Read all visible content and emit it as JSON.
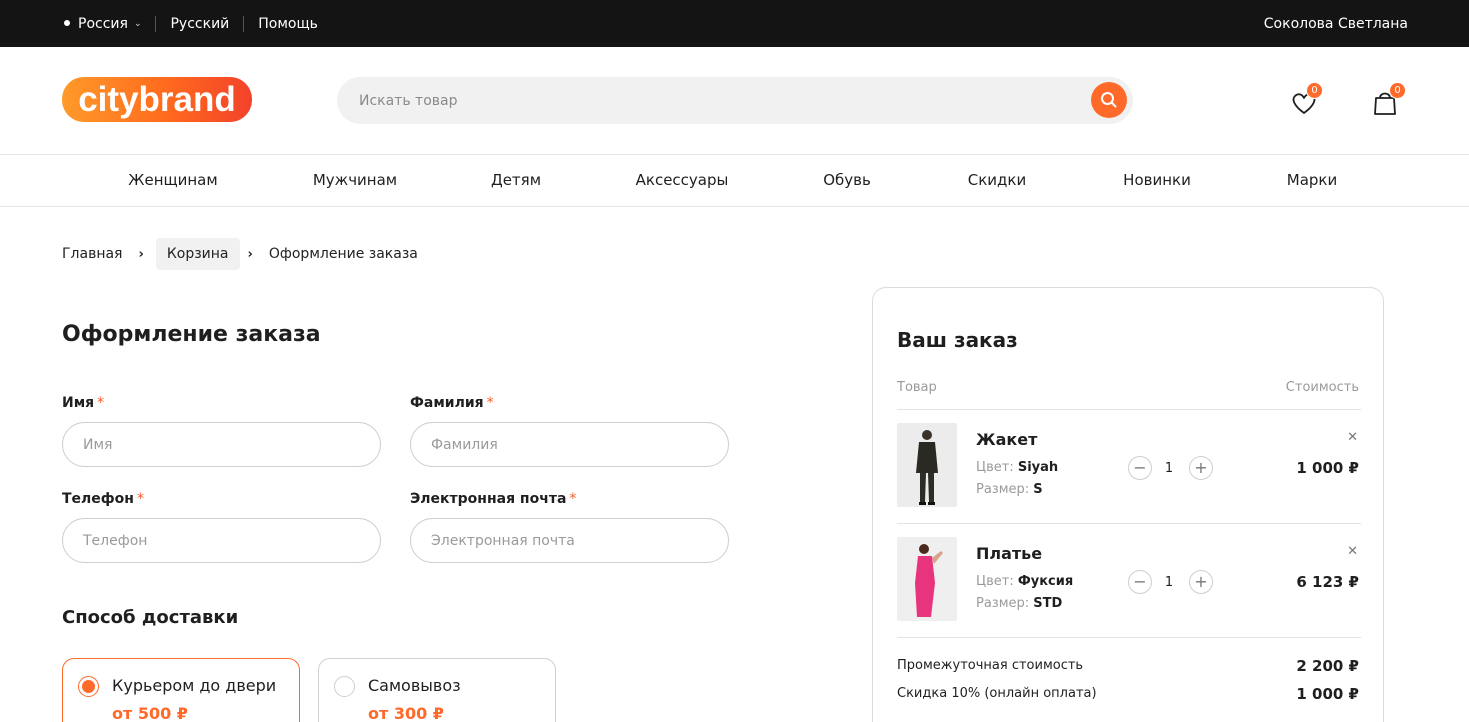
{
  "topbar": {
    "country": "Россия",
    "language": "Русский",
    "help": "Помощь",
    "user": "Соколова Светлана"
  },
  "header": {
    "logo_text": "citybrand",
    "search_placeholder": "Искать товар",
    "wishlist_count": "0",
    "cart_count": "0"
  },
  "nav": [
    "Женщинам",
    "Мужчинам",
    "Детям",
    "Аксессуары",
    "Обувь",
    "Скидки",
    "Новинки",
    "Марки"
  ],
  "breadcrumb": {
    "home": "Главная",
    "cart": "Корзина",
    "current": "Оформление заказа"
  },
  "form": {
    "title": "Оформление заказа",
    "first_name_label": "Имя",
    "first_name_placeholder": "Имя",
    "last_name_label": "Фамилия",
    "last_name_placeholder": "Фамилия",
    "phone_label": "Телефон",
    "phone_placeholder": "Телефон",
    "email_label": "Электронная почта",
    "email_placeholder": "Электронная почта",
    "required_mark": "*"
  },
  "delivery": {
    "title": "Способ доставки",
    "options": [
      {
        "name": "Курьером до двери",
        "price": "от 500 ₽",
        "selected": true
      },
      {
        "name": "Самовывоз",
        "price": "от 300 ₽",
        "selected": false
      }
    ]
  },
  "order": {
    "title": "Ваш заказ",
    "col_item": "Товар",
    "col_cost": "Стоимость",
    "color_label": "Цвет:",
    "size_label": "Размер:",
    "items": [
      {
        "name": "Жакет",
        "color": "Siyah",
        "size": "S",
        "qty": "1",
        "price": "1 000 ₽"
      },
      {
        "name": "Платье",
        "color": "Фуксия",
        "size": "STD",
        "qty": "1",
        "price": "6 123 ₽"
      }
    ],
    "subtotal_label": "Промежуточная стоимость",
    "subtotal_value": "2 200 ₽",
    "discount_label": "Скидка 10% (онлайн оплата)",
    "discount_value": "1 000 ₽"
  },
  "colors": {
    "accent": "#ff6a2a",
    "topbar": "#141414"
  }
}
